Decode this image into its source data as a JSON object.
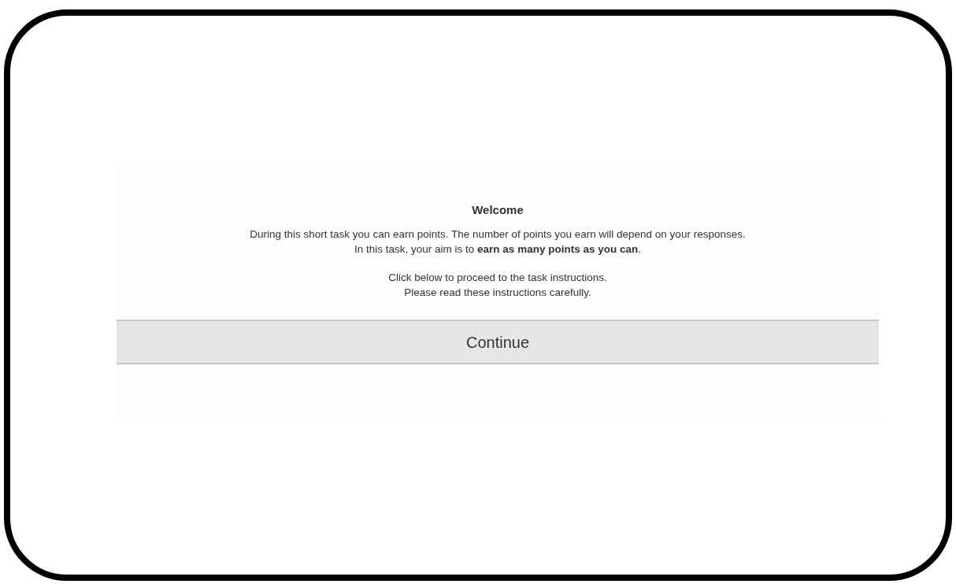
{
  "title": "Welcome",
  "paragraphs": [
    {
      "lines": [
        "During this short task you can earn points. The number of points you earn will depend on your responses.",
        "In this task, your aim is to **earn as many points as you can**."
      ]
    },
    {
      "lines": [
        "Click below to proceed to the task instructions.",
        "Please read these instructions carefully."
      ]
    }
  ],
  "button": "Continue"
}
